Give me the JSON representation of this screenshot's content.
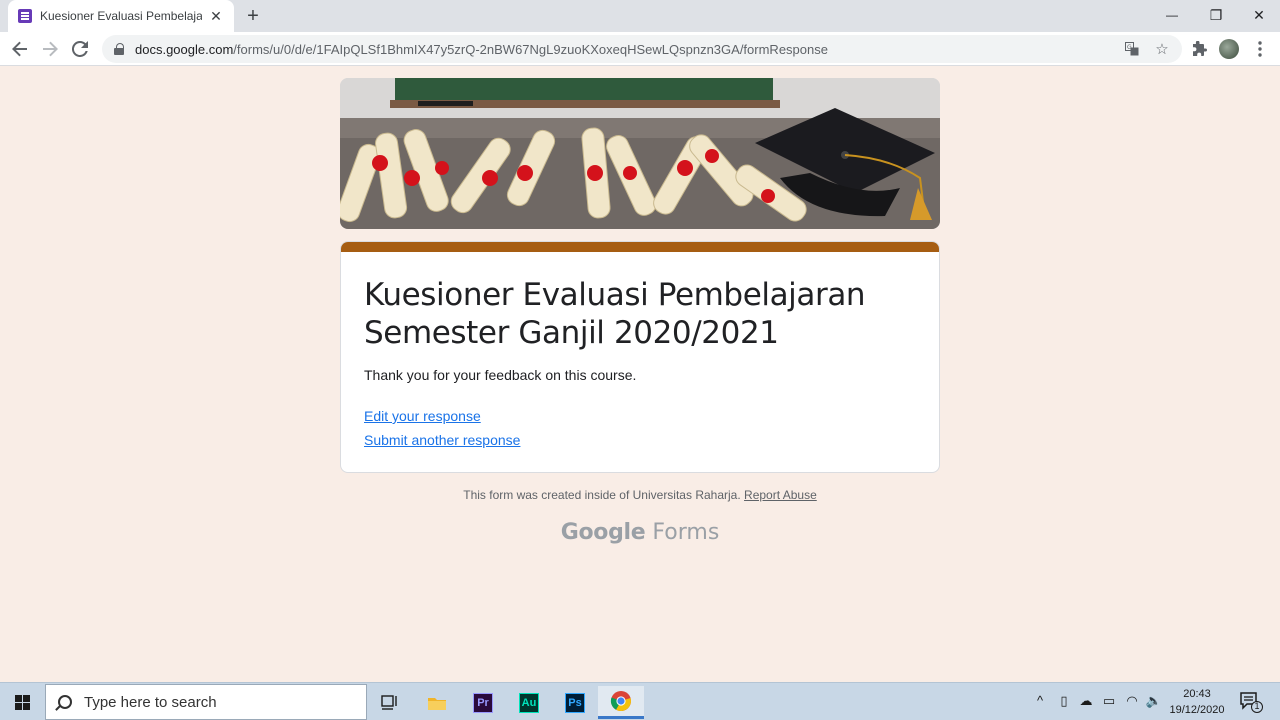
{
  "browser": {
    "tab_title": "Kuesioner Evaluasi Pembelajaran",
    "tab_close": "✕",
    "new_tab": "+",
    "url_host": "docs.google.com",
    "url_path": "/forms/u/0/d/e/1FAIpQLSf1BhmIX47y5zrQ-2nBW67NgL9zuoKXoxeqHSewLQspnzn3GA/formResponse",
    "window_controls": {
      "minimize": "—",
      "restore": "❐",
      "close": "✕"
    }
  },
  "form": {
    "title_line1": "Kuesioner Evaluasi Pembelajaran",
    "title_line2": "Semester Ganjil 2020/2021",
    "confirmation": "Thank you for your feedback on this course.",
    "edit_link": "Edit your response",
    "another_link": "Submit another response",
    "accent_color": "#a65d12"
  },
  "footer": {
    "note": "This form was created inside of Universitas Raharja.",
    "report_abuse": "Report Abuse",
    "brand_google": "Google",
    "brand_forms": "Forms"
  },
  "taskbar": {
    "search_placeholder": "Type here to search",
    "apps": [
      {
        "name": "task-view",
        "icon": "task-view-icon"
      },
      {
        "name": "file-explorer",
        "icon": "folder-icon"
      },
      {
        "name": "premiere-pro",
        "label": "Pr",
        "color": "#9999ff"
      },
      {
        "name": "audition",
        "label": "Au",
        "color": "#00e4bb"
      },
      {
        "name": "photoshop",
        "label": "Ps",
        "color": "#31a8ff"
      },
      {
        "name": "chrome",
        "icon": "chrome-icon",
        "active": true
      }
    ],
    "time": "20:43",
    "date": "19/12/2020",
    "notification_count": "1"
  }
}
